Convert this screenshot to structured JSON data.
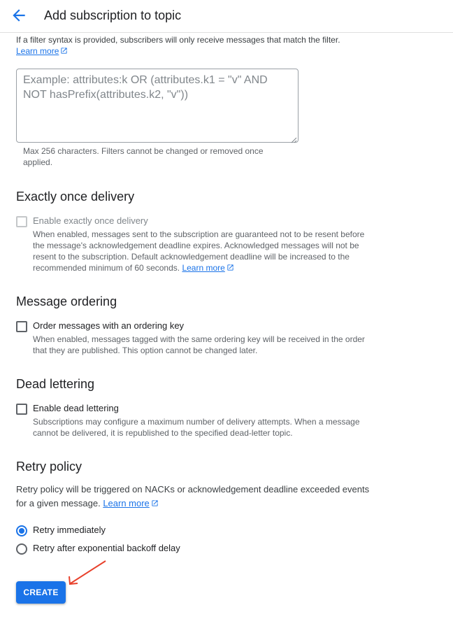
{
  "header": {
    "title": "Add subscription to topic"
  },
  "filter": {
    "help_text": "If a filter syntax is provided, subscribers will only receive messages that match the filter.",
    "learn_more": "Learn more",
    "placeholder": "Example: attributes:k OR (attributes.k1 = \"v\" AND NOT hasPrefix(attributes.k2, \"v\"))",
    "value": "",
    "hint": "Max 256 characters. Filters cannot be changed or removed once applied."
  },
  "exactly_once": {
    "title": "Exactly once delivery",
    "checkbox_label": "Enable exactly once delivery",
    "checked": false,
    "disabled": true,
    "description": "When enabled, messages sent to the subscription are guaranteed not to be resent before the message's acknowledgement deadline expires. Acknowledged messages will not be resent to the subscription. Default acknowledgement deadline will be increased to the recommended minimum of 60 seconds.",
    "learn_more": "Learn more"
  },
  "message_ordering": {
    "title": "Message ordering",
    "checkbox_label": "Order messages with an ordering key",
    "checked": false,
    "description": "When enabled, messages tagged with the same ordering key will be received in the order that they are published. This option cannot be changed later."
  },
  "dead_lettering": {
    "title": "Dead lettering",
    "checkbox_label": "Enable dead lettering",
    "checked": false,
    "description": "Subscriptions may configure a maximum number of delivery attempts. When a message cannot be delivered, it is republished to the specified dead-letter topic."
  },
  "retry_policy": {
    "title": "Retry policy",
    "description": "Retry policy will be triggered on NACKs or acknowledgement deadline exceeded events for a given message.",
    "learn_more": "Learn more",
    "options": [
      {
        "label": "Retry immediately",
        "selected": true
      },
      {
        "label": "Retry after exponential backoff delay",
        "selected": false
      }
    ]
  },
  "actions": {
    "create_label": "CREATE"
  },
  "colors": {
    "accent": "#1a73e8",
    "annotation_arrow": "#e8412c"
  }
}
